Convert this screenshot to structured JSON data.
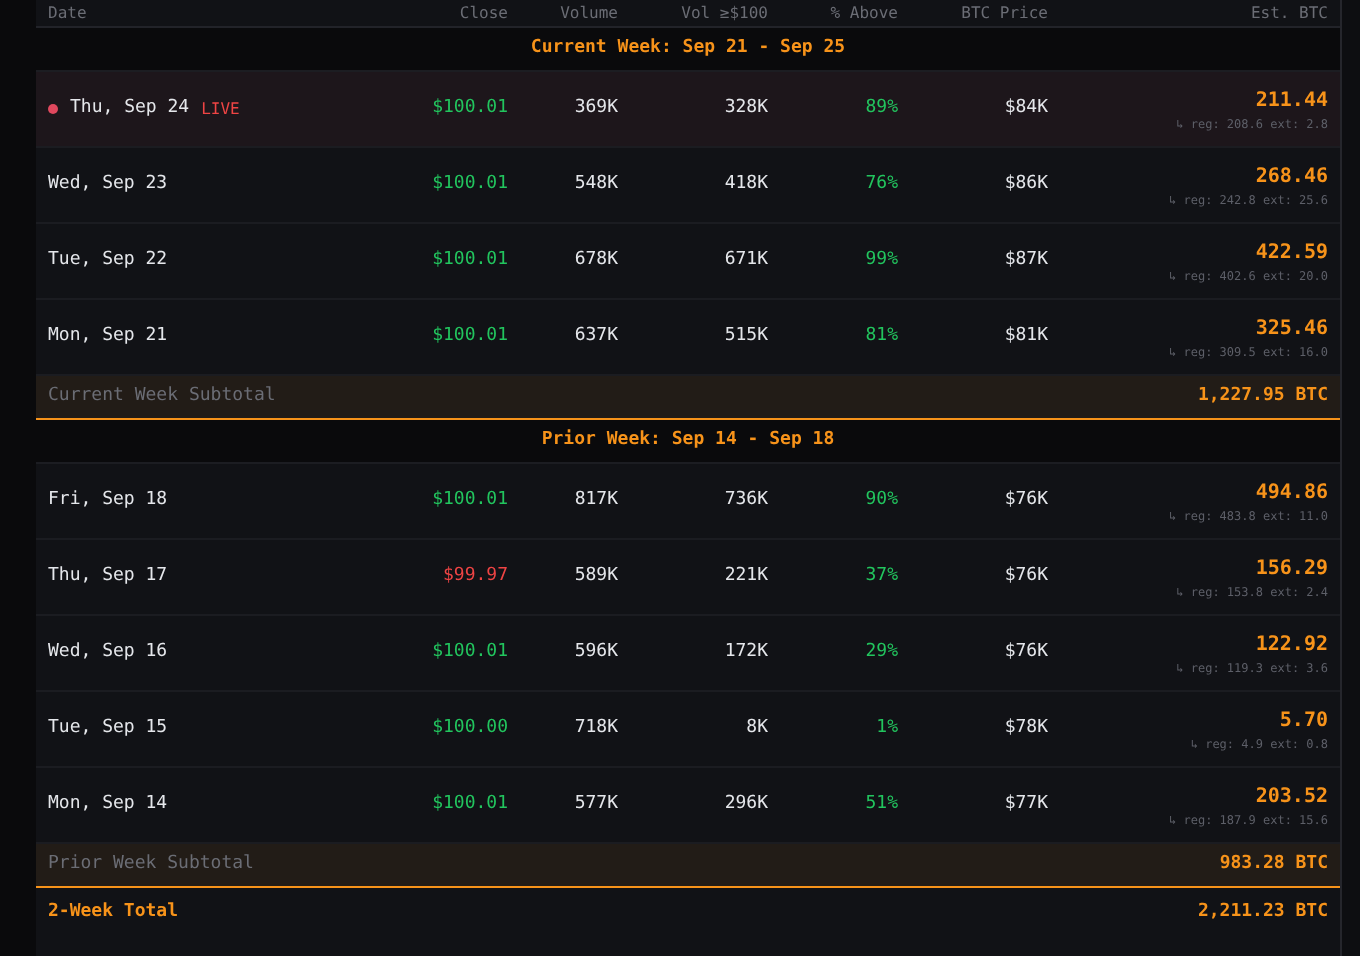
{
  "table": {
    "columns": [
      "Date",
      "Close",
      "Volume",
      "Vol ≥$100",
      "% Above",
      "BTC Price",
      "Est. BTC"
    ],
    "sections": [
      {
        "title": "Current Week: Sep 21 - Sep 25",
        "rows": [
          {
            "date": "Thu, Sep 24",
            "live": true,
            "live_label": "LIVE",
            "close": "$100.01",
            "negative": false,
            "volume": "369K",
            "vol_100": "328K",
            "above": "89%",
            "btc_price": "$84K",
            "est_btc": "211.44",
            "breakdown": "↳ reg: 208.6 ext: 2.8"
          },
          {
            "date": "Wed, Sep 23",
            "live": false,
            "close": "$100.01",
            "negative": false,
            "volume": "548K",
            "vol_100": "418K",
            "above": "76%",
            "btc_price": "$86K",
            "est_btc": "268.46",
            "breakdown": "↳ reg: 242.8 ext: 25.6"
          },
          {
            "date": "Tue, Sep 22",
            "live": false,
            "close": "$100.01",
            "negative": false,
            "volume": "678K",
            "vol_100": "671K",
            "above": "99%",
            "btc_price": "$87K",
            "est_btc": "422.59",
            "breakdown": "↳ reg: 402.6 ext: 20.0"
          },
          {
            "date": "Mon, Sep 21",
            "live": false,
            "close": "$100.01",
            "negative": false,
            "volume": "637K",
            "vol_100": "515K",
            "above": "81%",
            "btc_price": "$81K",
            "est_btc": "325.46",
            "breakdown": "↳ reg: 309.5 ext: 16.0"
          }
        ],
        "subtotal_label": "Current Week Subtotal",
        "subtotal": "1,227.95 BTC"
      },
      {
        "title": "Prior Week: Sep 14 - Sep 18",
        "rows": [
          {
            "date": "Fri, Sep 18",
            "live": false,
            "close": "$100.01",
            "negative": false,
            "volume": "817K",
            "vol_100": "736K",
            "above": "90%",
            "btc_price": "$76K",
            "est_btc": "494.86",
            "breakdown": "↳ reg: 483.8 ext: 11.0"
          },
          {
            "date": "Thu, Sep 17",
            "live": false,
            "close": "$99.97",
            "negative": true,
            "volume": "589K",
            "vol_100": "221K",
            "above": "37%",
            "btc_price": "$76K",
            "est_btc": "156.29",
            "breakdown": "↳ reg: 153.8 ext: 2.4"
          },
          {
            "date": "Wed, Sep 16",
            "live": false,
            "close": "$100.01",
            "negative": false,
            "volume": "596K",
            "vol_100": "172K",
            "above": "29%",
            "btc_price": "$76K",
            "est_btc": "122.92",
            "breakdown": "↳ reg: 119.3 ext: 3.6"
          },
          {
            "date": "Tue, Sep 15",
            "live": false,
            "close": "$100.00",
            "negative": false,
            "volume": "718K",
            "vol_100": "8K",
            "above": "1%",
            "btc_price": "$78K",
            "est_btc": "5.70",
            "breakdown": "↳ reg: 4.9 ext: 0.8"
          },
          {
            "date": "Mon, Sep 14",
            "live": false,
            "close": "$100.01",
            "negative": false,
            "volume": "577K",
            "vol_100": "296K",
            "above": "51%",
            "btc_price": "$77K",
            "est_btc": "203.52",
            "breakdown": "↳ reg: 187.9 ext: 15.6"
          }
        ],
        "subtotal_label": "Prior Week Subtotal",
        "subtotal": "983.28 BTC"
      }
    ],
    "total_label": "2-Week Total",
    "total": "2,211.23 BTC"
  }
}
